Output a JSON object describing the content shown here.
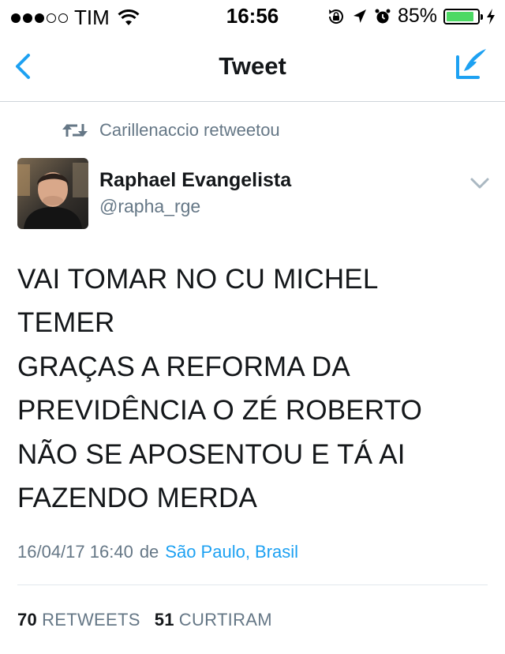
{
  "status_bar": {
    "signal_dots_filled": 3,
    "signal_dots_total": 5,
    "carrier": "TIM",
    "time": "16:56",
    "battery_percent": "85%",
    "icons": [
      "wifi-icon",
      "rotation-lock-icon",
      "location-arrow-icon",
      "alarm-icon",
      "battery-icon",
      "charging-bolt-icon"
    ]
  },
  "nav": {
    "title": "Tweet",
    "back_icon": "back-chevron-icon",
    "compose_icon": "compose-quill-icon"
  },
  "retweet_context": {
    "text": "Carillenaccio retweetou",
    "icon": "retweet-icon"
  },
  "author": {
    "name": "Raphael Evangelista",
    "handle": "@rapha_rge",
    "menu_icon": "chevron-down-icon"
  },
  "tweet": {
    "lines": [
      "VAI TOMAR NO CU MICHEL",
      "TEMER",
      "GRAÇAS A REFORMA DA",
      "PREVIDÊNCIA O ZÉ ROBERTO",
      "NÃO SE APOSENTOU E TÁ AI",
      "FAZENDO MERDA"
    ],
    "timestamp": "16/04/17 16:40",
    "from_label": "de",
    "location": "São Paulo, Brasil"
  },
  "stats": {
    "retweets_count": "70",
    "retweets_label": "RETWEETS",
    "likes_count": "51",
    "likes_label": "CURTIRAM"
  },
  "colors": {
    "accent": "#1da1f2",
    "secondary_text": "#657786",
    "primary_text": "#14171a",
    "battery_fill": "#4cd964"
  }
}
